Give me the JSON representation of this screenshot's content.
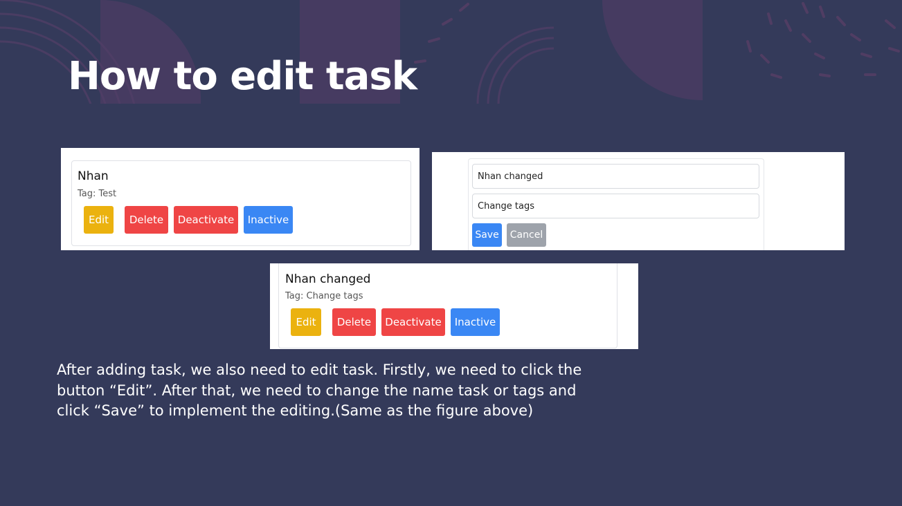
{
  "slide": {
    "title": "How to edit task",
    "description": "After adding task, we also need to edit task. Firstly, we need to click the button “Edit”. After that, we need to change the name task or tags and click “Save” to implement the editing.(Same as the figure above)"
  },
  "task_before": {
    "name": "Nhan",
    "tag": "Tag: Test",
    "buttons": {
      "edit": "Edit",
      "delete": "Delete",
      "deactivate": "Deactivate",
      "inactive": "Inactive"
    }
  },
  "edit_form": {
    "name_value": "Nhan changed",
    "tags_value": "Change tags",
    "save": "Save",
    "cancel": "Cancel"
  },
  "task_after": {
    "name": "Nhan changed",
    "tag": "Tag: Change tags",
    "buttons": {
      "edit": "Edit",
      "delete": "Delete",
      "deactivate": "Deactivate",
      "inactive": "Inactive"
    }
  },
  "colors": {
    "background": "#343a5a",
    "edit": "#ebb20f",
    "delete": "#ef4545",
    "inactive": "#3a87f4",
    "cancel": "#9ea3ab"
  }
}
